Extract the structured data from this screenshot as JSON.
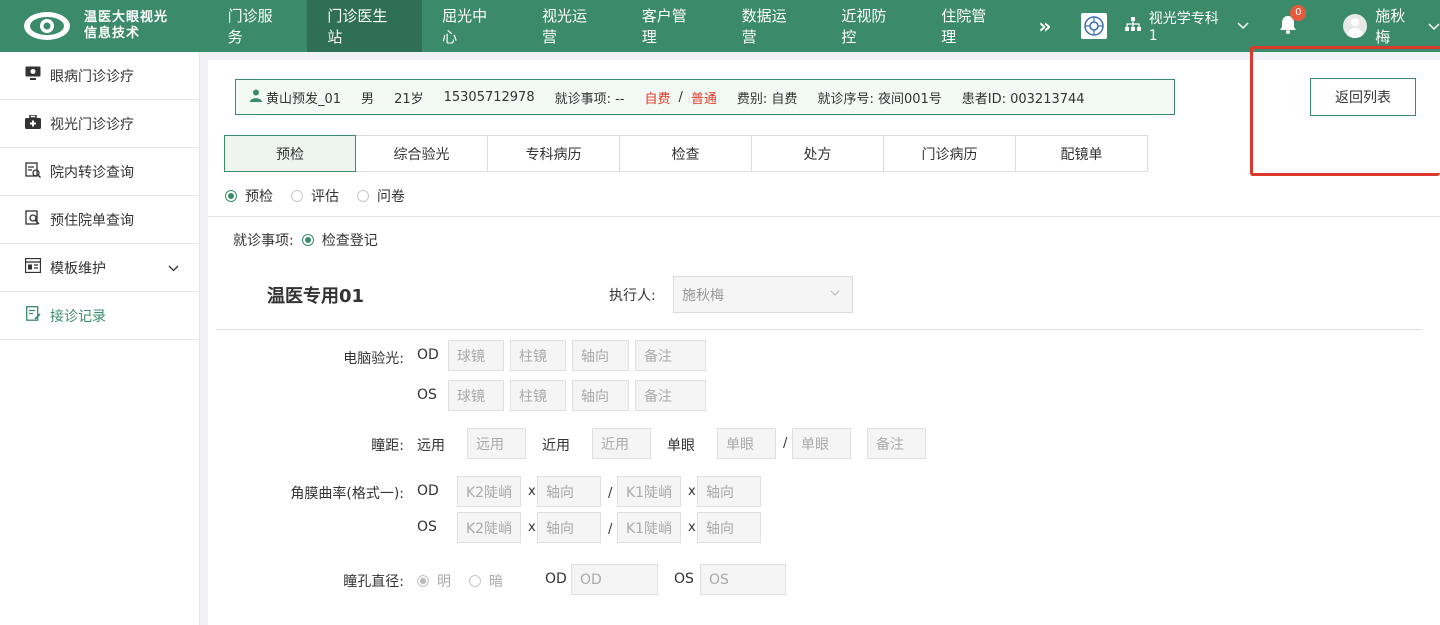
{
  "brand": {
    "line1": "温医大眼视光",
    "line2": "信息技术"
  },
  "nav": {
    "items": [
      "门诊服务",
      "门诊医生站",
      "屈光中心",
      "视光运营",
      "客户管理",
      "数据运营",
      "近视防控",
      "住院管理"
    ],
    "more": "»",
    "dept": "视光学专科1",
    "notifications": "0",
    "user": "施秋梅"
  },
  "sidebar": {
    "items": [
      {
        "label": "眼病门诊诊疗",
        "icon": "monitor-icon"
      },
      {
        "label": "视光门诊诊疗",
        "icon": "medkit-icon"
      },
      {
        "label": "院内转诊查询",
        "icon": "transfer-icon"
      },
      {
        "label": "预住院单查询",
        "icon": "search-doc-icon"
      },
      {
        "label": "模板维护",
        "icon": "template-icon"
      },
      {
        "label": "接诊记录",
        "icon": "record-icon"
      }
    ]
  },
  "patient": {
    "name": "黄山预发_01",
    "gender": "男",
    "age": "21岁",
    "phone": "15305712978",
    "visit_item": "就诊事项: --",
    "pay1": "自费",
    "slash": "/",
    "pay2": "普通",
    "fee_type": "费别: 自费",
    "seq": "就诊序号: 夜间001号",
    "pid": "患者ID: 003213744"
  },
  "back_label": "返回列表",
  "tabs": [
    "预检",
    "综合验光",
    "专科病历",
    "检查",
    "处方",
    "门诊病历",
    "配镜单"
  ],
  "subradios": [
    "预检",
    "评估",
    "问卷"
  ],
  "visit": {
    "label": "就诊事项:",
    "value": "检查登记"
  },
  "form": {
    "title": "温医专用01",
    "exec_label": "执行人:",
    "exec_value": "施秋梅",
    "refraction_label": "电脑验光:",
    "od": "OD",
    "os": "OS",
    "sph": "球镜",
    "cyl": "柱镜",
    "axis": "轴向",
    "note": "备注",
    "pd_label": "瞳距:",
    "far": "远用",
    "near": "近用",
    "mono": "单眼",
    "slash": "/",
    "kera_label": "角膜曲率(格式一):",
    "k2": "K2陡峭",
    "k1": "K1陡峭",
    "x": "x",
    "pupil_label": "瞳孔直径:",
    "bright": "明",
    "dark": "暗"
  },
  "colors": {
    "primary": "#3b8a6a",
    "active_nav": "#2f6f56",
    "alert": "#e23b2a"
  }
}
